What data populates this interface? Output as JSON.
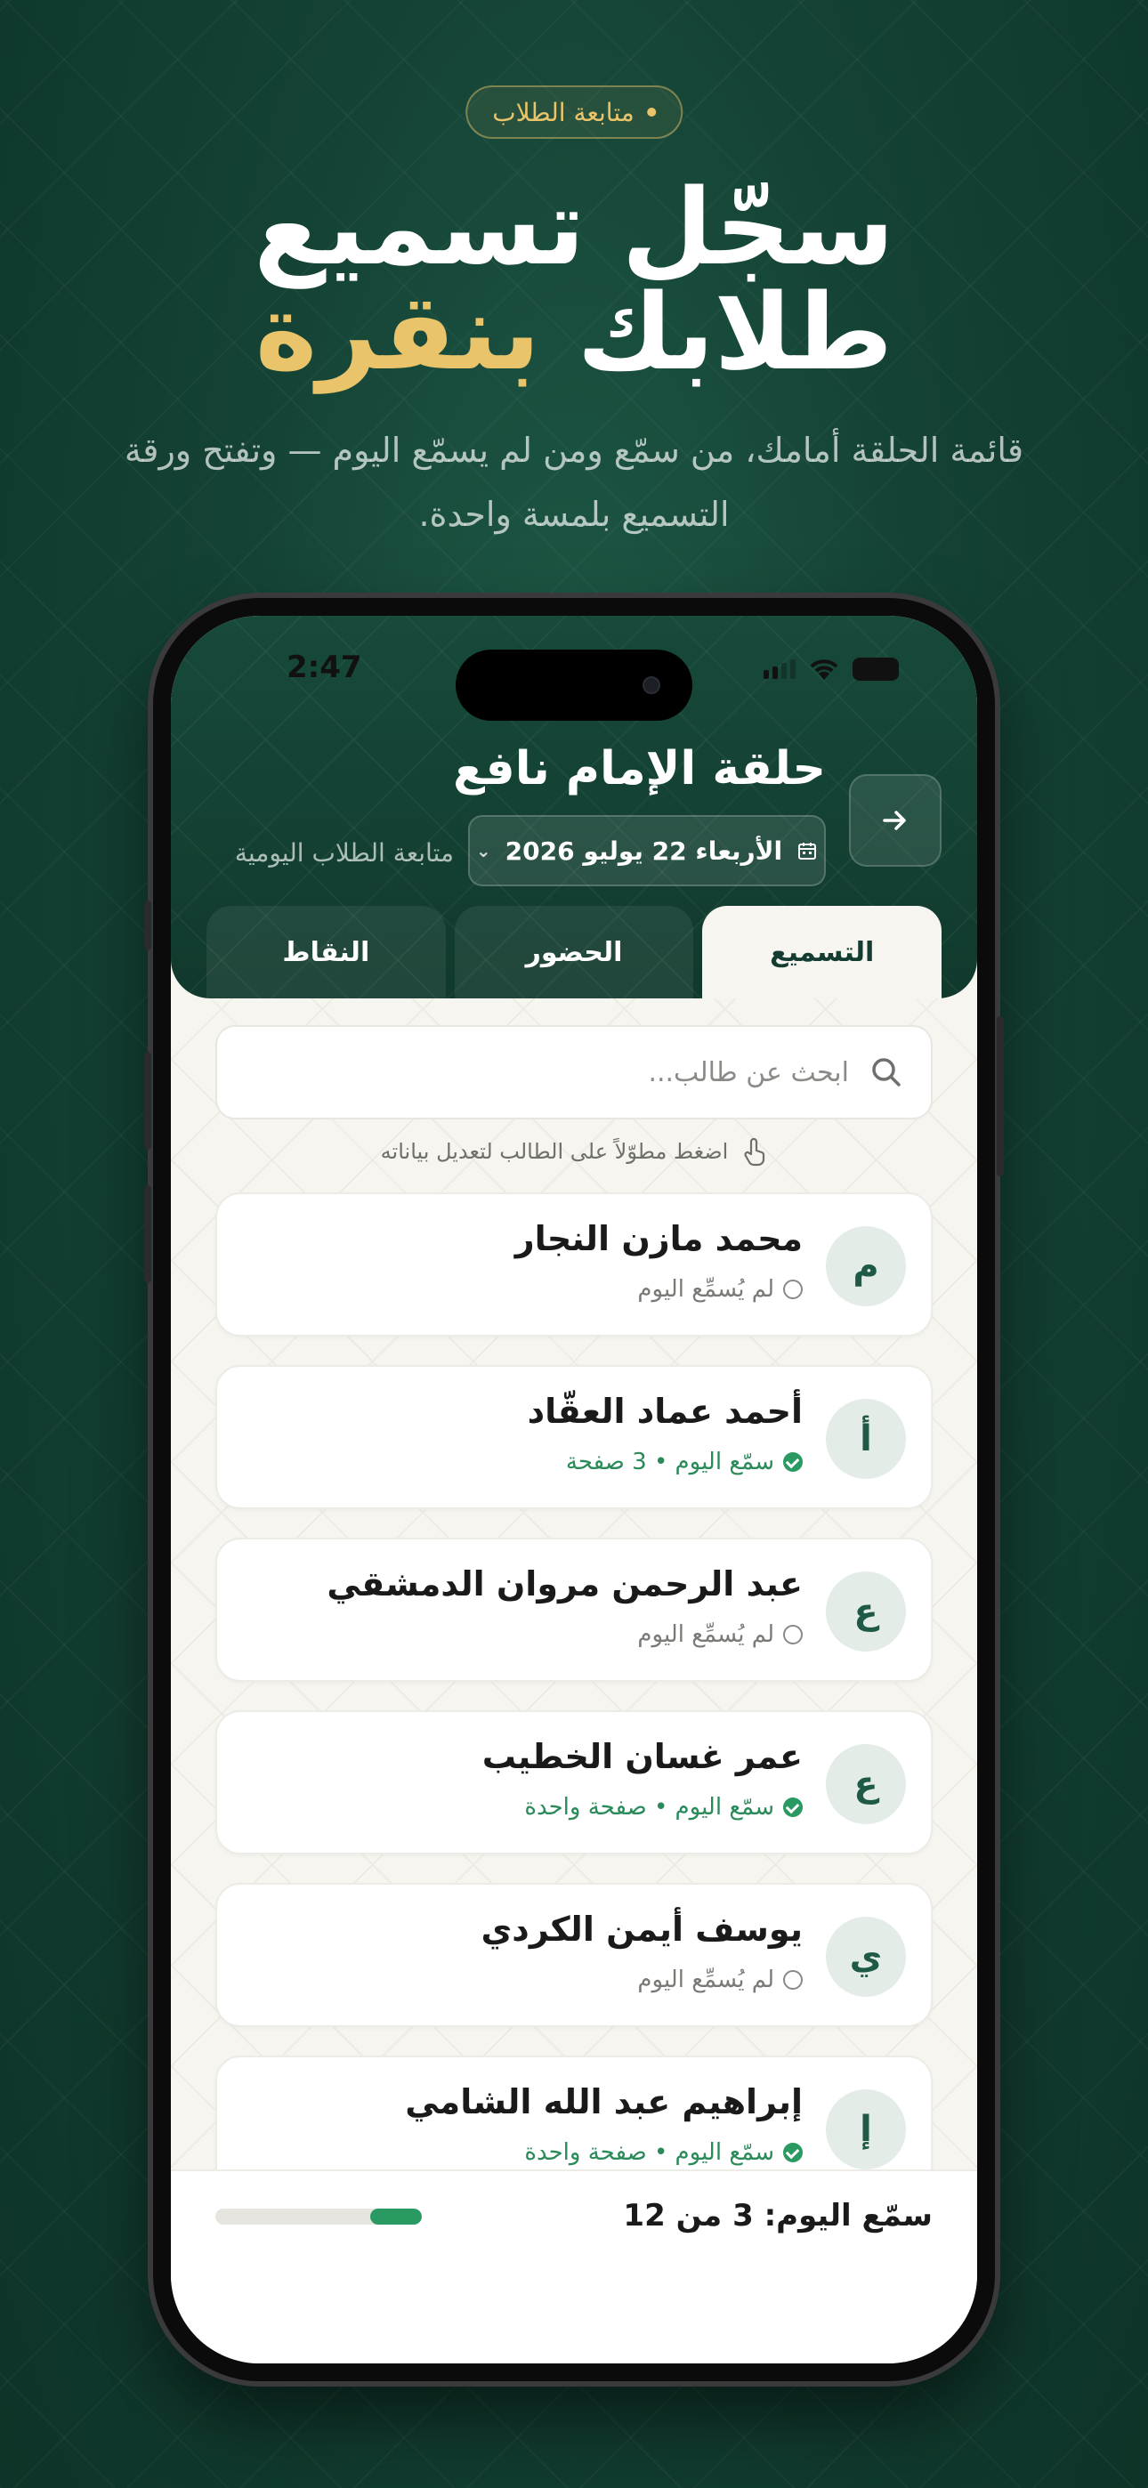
{
  "promo": {
    "eyebrow": "متابعة الطلاب",
    "headline_line1": "سجّل تسميع",
    "headline_line2_part1": "طلابك",
    "headline_line2_accent": "بنقرة",
    "subline": "قائمة الحلقة أمامك، من سمّع ومن لم يسمّع اليوم — وتفتح ورقة التسميع بلمسة واحدة."
  },
  "status_bar": {
    "time": "2:47"
  },
  "app": {
    "title": "حلقة الإمام نافع",
    "subtitle": "متابعة الطلاب اليومية",
    "date": "الأربعاء 22 يوليو 2026",
    "tabs": [
      {
        "label": "التسميع",
        "active": true
      },
      {
        "label": "الحضور",
        "active": false
      },
      {
        "label": "النقاط",
        "active": false
      }
    ],
    "search_placeholder": "ابحث عن طالب...",
    "hint": "اضغط مطوّلاً على الطالب لتعديل بياناته",
    "students": [
      {
        "initial": "م",
        "name": "محمد مازن النجار",
        "status": "لم يُسمِّع اليوم",
        "recited": false
      },
      {
        "initial": "أ",
        "name": "أحمد عماد العقّاد",
        "status": "سمّع اليوم • 3 صفحة",
        "recited": true
      },
      {
        "initial": "ع",
        "name": "عبد الرحمن مروان الدمشقي",
        "status": "لم يُسمِّع اليوم",
        "recited": false
      },
      {
        "initial": "ع",
        "name": "عمر غسان الخطيب",
        "status": "سمّع اليوم • صفحة واحدة",
        "recited": true
      },
      {
        "initial": "ي",
        "name": "يوسف أيمن الكردي",
        "status": "لم يُسمِّع اليوم",
        "recited": false
      },
      {
        "initial": "إ",
        "name": "إبراهيم عبد الله الشامي",
        "status": "سمّع اليوم • صفحة واحدة",
        "recited": true
      }
    ],
    "footer": {
      "progress_label": "سمّع اليوم: 3 من 12",
      "recited": 3,
      "total": 12
    }
  },
  "colors": {
    "accent_gold": "#e9c46a",
    "brand_green": "#174a3b",
    "success": "#2a9a63"
  }
}
